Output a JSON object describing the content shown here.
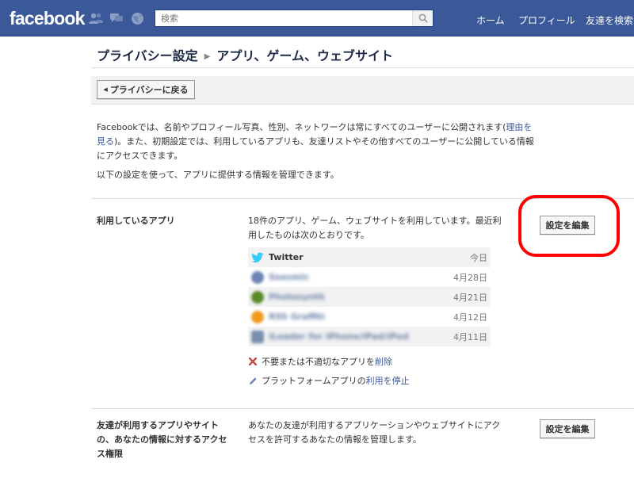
{
  "header": {
    "logo": "facebook",
    "search_placeholder": "検索",
    "nav": [
      "ホーム",
      "プロフィール",
      "友達を検索"
    ]
  },
  "breadcrumb": {
    "parent": "プライバシー設定",
    "current": "アプリ、ゲーム、ウェブサイト"
  },
  "back_button": "プライバシーに戻る",
  "intro": {
    "text_before_link": "Facebookでは、名前やプロフィール写真、性別、ネットワークは常にすべてのユーザーに公開されます(",
    "link": "理由を見る",
    "text_after_link": ")。また、初期設定では、利用しているアプリも、友達リストやその他すべてのユーザーに公開している情報にアクセスできます。",
    "line2": "以下の設定を使って、アプリに提供する情報を管理できます。"
  },
  "section_apps": {
    "title": "利用しているアプリ",
    "description": "18件のアプリ、ゲーム、ウェブサイトを利用しています。最近利用したものは次のとおりです。",
    "edit_button": "設定を編集",
    "apps": [
      {
        "name": "Twitter",
        "date": "今日",
        "icon": "twitter-icon"
      },
      {
        "name": "Seesmic",
        "date": "4月28日",
        "icon": "app-icon"
      },
      {
        "name": "Photosynth",
        "date": "4月21日",
        "icon": "app-icon"
      },
      {
        "name": "RSS Graffiti",
        "date": "4月12日",
        "icon": "app-icon"
      },
      {
        "name": "iLoader for iPhone/iPad/iPod",
        "date": "4月11日",
        "icon": "app-icon"
      }
    ],
    "remove_action": {
      "text": "不要または不適切なアプリを",
      "link": "削除"
    },
    "stop_action": {
      "text": "プラットフォームアプリの",
      "link": "利用を停止"
    }
  },
  "section_friends": {
    "title": "友達が利用するアプリやサイトの、あなたの情報に対するアクセス権限",
    "description": "あなたの友達が利用するアプリケーションやウェブサイトにアクセスを許可するあなたの情報を管理します。",
    "edit_button": "設定を編集"
  },
  "colors": {
    "brand": "#3b5998",
    "highlight_circle": "#ff0000"
  }
}
